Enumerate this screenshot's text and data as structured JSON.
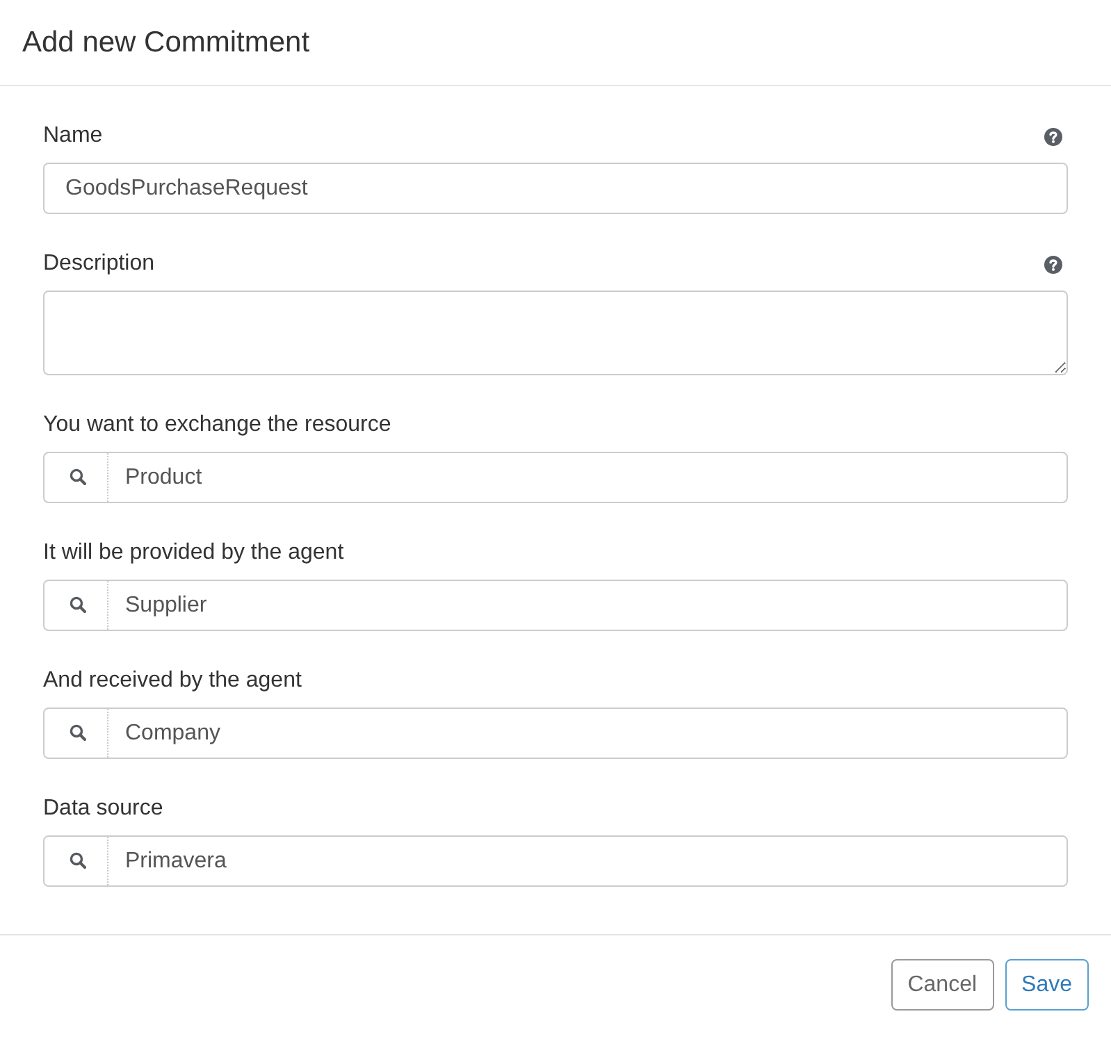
{
  "dialog": {
    "title": "Add new Commitment"
  },
  "fields": [
    {
      "kind": "text",
      "label": "Name",
      "help": true,
      "value": "GoodsPurchaseRequest"
    },
    {
      "kind": "textarea",
      "label": "Description",
      "help": true
    },
    {
      "kind": "search",
      "label": "You want to exchange the resource",
      "help": false,
      "value": "Product"
    },
    {
      "kind": "search",
      "label": "It will be provided by the agent",
      "help": false,
      "value": "Supplier"
    },
    {
      "kind": "search",
      "label": "And received by the agent",
      "help": false,
      "value": "Company"
    },
    {
      "kind": "search",
      "label": "Data source",
      "help": false,
      "value": "Primavera"
    }
  ],
  "buttons": [
    {
      "kind": "default",
      "label": "Cancel"
    },
    {
      "kind": "primary",
      "label": "Save"
    }
  ]
}
